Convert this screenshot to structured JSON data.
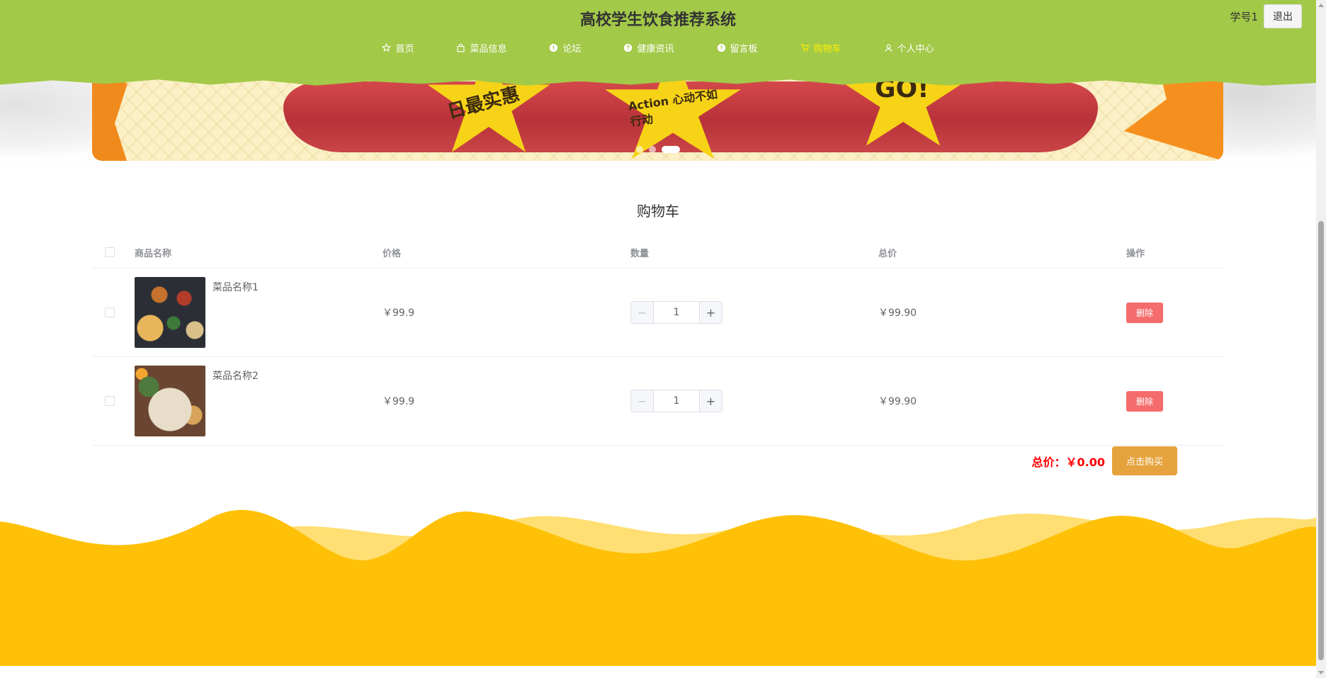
{
  "header": {
    "title": "高校学生饮食推荐系统",
    "user_name": "学号1",
    "logout_label": "退出",
    "bg_color": "#a2c948",
    "nav": [
      {
        "label": "首页",
        "icon": "star-icon",
        "active": false
      },
      {
        "label": "菜品信息",
        "icon": "bag-icon",
        "active": false
      },
      {
        "label": "论坛",
        "icon": "info-icon",
        "active": false
      },
      {
        "label": "健康资讯",
        "icon": "help-icon",
        "active": false
      },
      {
        "label": "留言板",
        "icon": "info-icon",
        "active": false
      },
      {
        "label": "购物车",
        "icon": "cart-icon",
        "active": true
      },
      {
        "label": "个人中心",
        "icon": "user-icon",
        "active": false
      }
    ]
  },
  "carousel": {
    "star_texts": [
      "日最实惠",
      "Action 心动不如行动",
      "GO!"
    ],
    "slides": 3,
    "active_slide": 3
  },
  "cart": {
    "title": "购物车",
    "columns": [
      "商品名称",
      "价格",
      "数量",
      "总价",
      "操作"
    ],
    "items": [
      {
        "name": "菜品名称1",
        "price": "￥99.9",
        "quantity": "1",
        "total": "￥99.90",
        "delete_label": "删除"
      },
      {
        "name": "菜品名称2",
        "price": "￥99.9",
        "quantity": "1",
        "total": "￥99.90",
        "delete_label": "删除"
      }
    ],
    "summary_label": "总价：￥0.00",
    "buy_label": "点击购买"
  },
  "colors": {
    "accent_active_nav": "#fff000",
    "delete_button": "#f56c6c",
    "buy_button": "#e6a23c",
    "total_text": "#ff0000",
    "footer_wave": "#ffc107",
    "footer_wave_light": "#ffdf73"
  }
}
